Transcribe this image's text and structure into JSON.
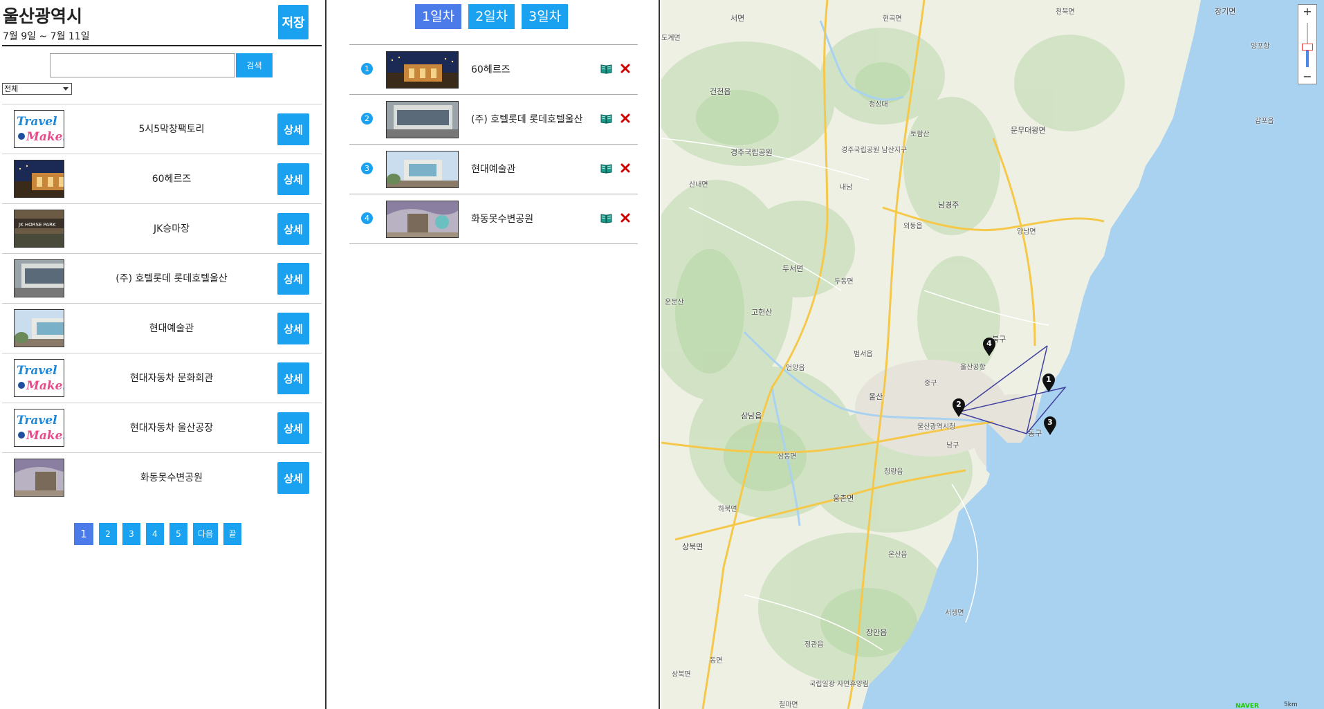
{
  "header": {
    "city": "울산광역시",
    "dates": "7월 9일 ~ 7월 11일",
    "save_label": "저장"
  },
  "search": {
    "value": "",
    "button_label": "검색",
    "filter_selected": "전체"
  },
  "places": [
    {
      "name": "5시5막창팩토리",
      "thumb": "travelmaker-logo",
      "detail_label": "상세"
    },
    {
      "name": "60헤르즈",
      "thumb": "photo-night-building",
      "detail_label": "상세"
    },
    {
      "name": "JK승마장",
      "thumb": "photo-horse-park",
      "detail_label": "상세"
    },
    {
      "name": "(주) 호텔롯데 롯데호텔울산",
      "thumb": "photo-hotel",
      "detail_label": "상세"
    },
    {
      "name": "현대예술관",
      "thumb": "photo-art-center",
      "detail_label": "상세"
    },
    {
      "name": "현대자동차 문화회관",
      "thumb": "travelmaker-logo",
      "detail_label": "상세"
    },
    {
      "name": "현대자동차 울산공장",
      "thumb": "travelmaker-logo",
      "detail_label": "상세"
    },
    {
      "name": "화동못수변공원",
      "thumb": "photo-park",
      "detail_label": "상세"
    }
  ],
  "logo_text": {
    "line1": "Travel",
    "line2": "Maker"
  },
  "pagination": {
    "pages": [
      "1",
      "2",
      "3",
      "4",
      "5"
    ],
    "active": "1",
    "next_label": "다음",
    "last_label": "끝"
  },
  "days": {
    "tabs": [
      "1일차",
      "2일차",
      "3일차"
    ],
    "active_index": 0
  },
  "schedule": [
    {
      "num": "1",
      "name": "60헤르즈",
      "thumb": "photo-night-building"
    },
    {
      "num": "2",
      "name": "(주) 호텔롯데 롯데호텔울산",
      "thumb": "photo-hotel"
    },
    {
      "num": "3",
      "name": "현대예술관",
      "thumb": "photo-art-center"
    },
    {
      "num": "4",
      "name": "화동못수변공원",
      "thumb": "photo-park"
    }
  ],
  "map": {
    "labels": [
      "서면",
      "현곡면",
      "천북면",
      "장기면",
      "도계면",
      "양포항",
      "건천읍",
      "청성대",
      "감포읍",
      "경주국립공원",
      "경주국립공원 남산지구",
      "토함산",
      "문무대왕면",
      "산내면",
      "내남",
      "남경주",
      "외동읍",
      "양남면",
      "두서면",
      "두동면",
      "운문산",
      "고헌산",
      "언양읍",
      "범서읍",
      "북구",
      "울산공항",
      "중구",
      "삼남읍",
      "울산광역시청",
      "남구",
      "동구",
      "삼동면",
      "청량읍",
      "웅촌면",
      "하북면",
      "온산읍",
      "상북면",
      "서생면",
      "정관읍",
      "장안읍",
      "동면",
      "철마면",
      "울산",
      "국립일광 자연휴양림",
      "상북면"
    ],
    "markers": [
      "1",
      "2",
      "3",
      "4"
    ],
    "scale_label": "5km",
    "provider": "NAVER",
    "zoom_in": "+",
    "zoom_out": "−"
  },
  "colors": {
    "accent": "#1aa1f0",
    "active": "#4a7be8",
    "route": "#3f3f9f",
    "sea": "#a9d2f0",
    "delete": "#d00000",
    "book": "#1a9a8a"
  }
}
